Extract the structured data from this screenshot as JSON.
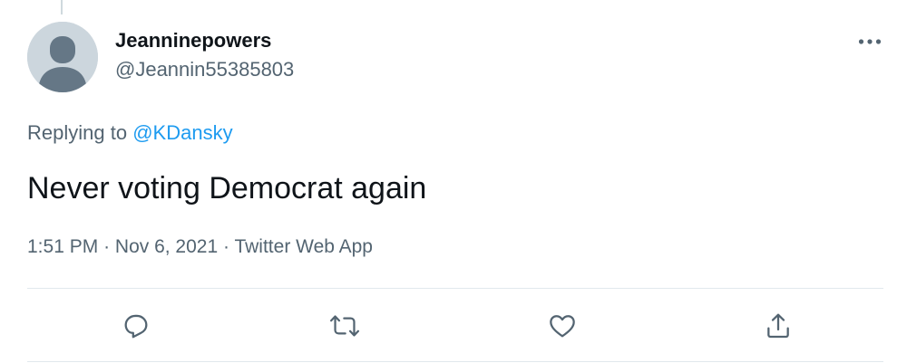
{
  "tweet": {
    "author": {
      "display_name": "Jeanninepowers",
      "handle": "@Jeannin55385803",
      "avatar_icon": "default-profile-icon"
    },
    "replying": {
      "prefix": "Replying to",
      "mention": "@KDansky"
    },
    "text": "Never voting Democrat again",
    "meta": {
      "time": "1:51 PM",
      "separator": "·",
      "date": "Nov 6, 2021",
      "source": "Twitter Web App"
    },
    "actions": [
      {
        "name": "reply",
        "icon": "reply-icon"
      },
      {
        "name": "retweet",
        "icon": "retweet-icon"
      },
      {
        "name": "like",
        "icon": "heart-icon"
      },
      {
        "name": "share",
        "icon": "share-icon"
      }
    ]
  },
  "colors": {
    "text_primary": "#0f1419",
    "text_secondary": "#536471",
    "link": "#1d9bf0",
    "divider": "#e1e8ed",
    "avatar_bg": "#ccd6dd"
  }
}
